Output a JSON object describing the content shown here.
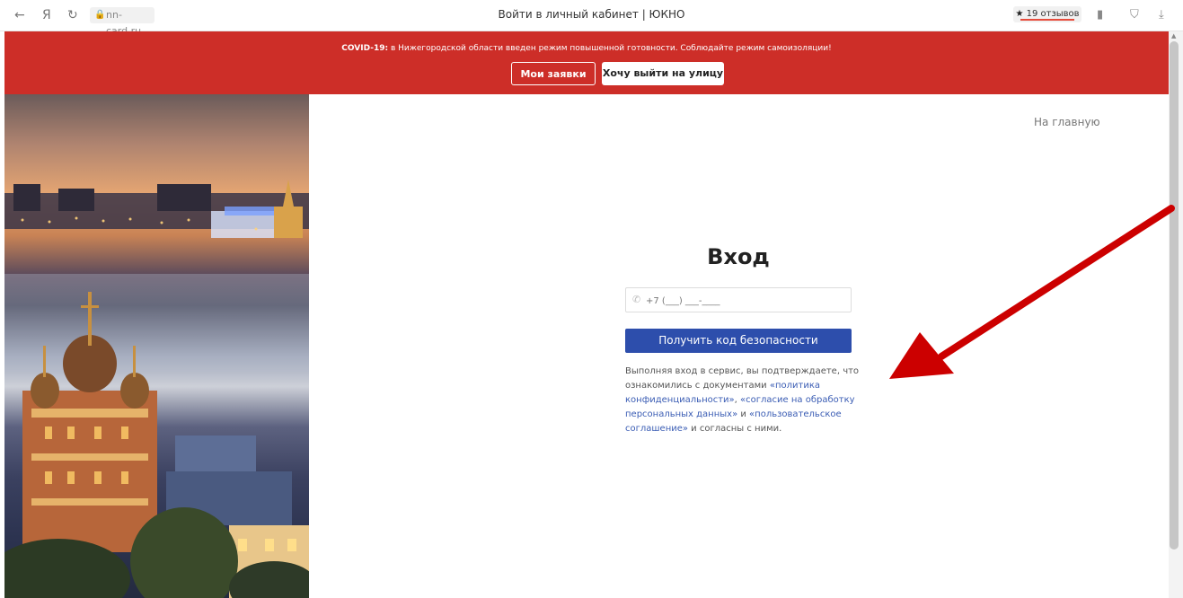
{
  "browser": {
    "nav": {
      "back_icon": "←",
      "yandex_icon": "Я",
      "reload_icon": "↻"
    },
    "url": "nn-card.ru",
    "tab_title": "Войти в личный кабинет | ЮКНО",
    "reviews": {
      "star": "★",
      "label": "19 отзывов"
    }
  },
  "banner": {
    "prefix": "COVID-19:",
    "text": " в Нижегородской области введен режим повышенной готовности. Соблюдайте режим самоизоляции!",
    "btn_requests": "Мои заявки",
    "btn_go_out": "Хочу выйти на улицу",
    "color": "#cd2e28"
  },
  "main": {
    "home_link": "На главную",
    "title": "Вход",
    "phone_placeholder": "+7 (___) ___-____",
    "submit_label": "Получить код безопасности",
    "consent": {
      "t1": "Выполняя вход в сервис, вы подтверждаете, что ознакомились с документами ",
      "l1": "«политика конфиденциальности»",
      "t2": ", ",
      "l2": "«согласие на обработку персональных данных»",
      "t3": " и ",
      "l3": "«пользовательское соглашение»",
      "t4": " и согласны с ними."
    },
    "button_color": "#2d4eac",
    "link_color": "#3b5db4"
  },
  "annotation": {
    "arrow_color": "#cc0000"
  }
}
